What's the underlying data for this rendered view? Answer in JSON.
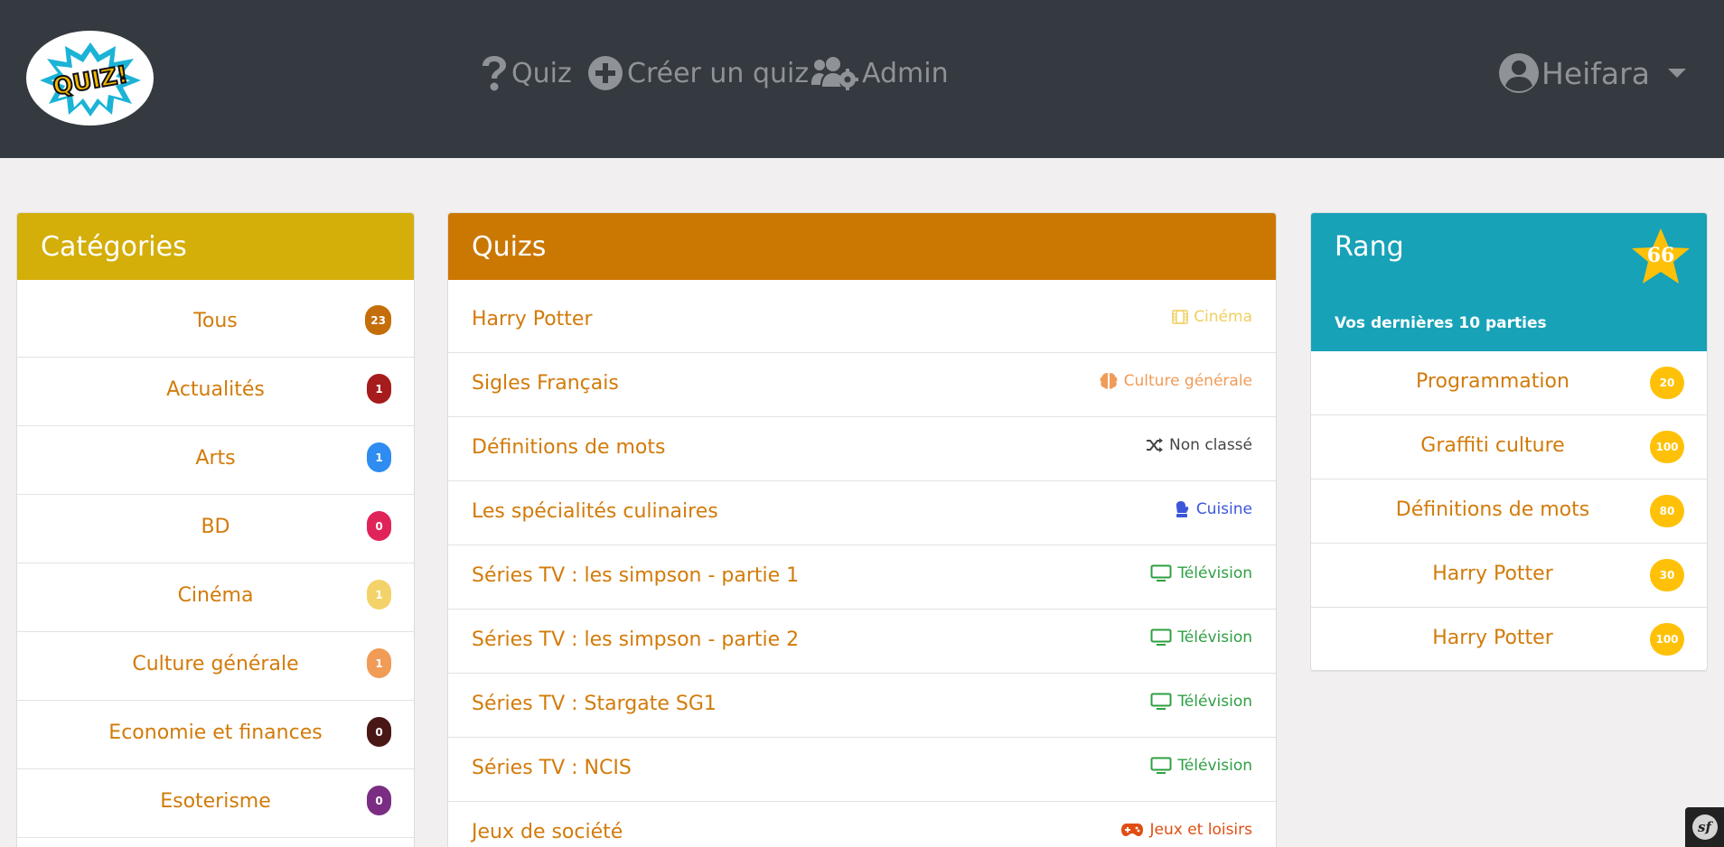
{
  "navbar": {
    "logo_text": "QUIZ!",
    "items": [
      {
        "label": "Quiz",
        "icon": "question-icon"
      },
      {
        "label": "Créer un quiz",
        "icon": "plus-circle-icon"
      },
      {
        "label": "Admin",
        "icon": "users-cog-icon"
      }
    ],
    "user": {
      "name": "Heifara",
      "icon": "user-circle-icon"
    }
  },
  "categories": {
    "title": "Catégories",
    "items": [
      {
        "label": "Tous",
        "count": "23",
        "color": "#c56e09"
      },
      {
        "label": "Actualités",
        "count": "1",
        "color": "#a61b1b"
      },
      {
        "label": "Arts",
        "count": "1",
        "color": "#2f8cf0"
      },
      {
        "label": "BD",
        "count": "0",
        "color": "#e0245a"
      },
      {
        "label": "Cinéma",
        "count": "1",
        "color": "#f3d369"
      },
      {
        "label": "Culture générale",
        "count": "1",
        "color": "#f09c57"
      },
      {
        "label": "Economie et finances",
        "count": "0",
        "color": "#4a1717"
      },
      {
        "label": "Esoterisme",
        "count": "0",
        "color": "#7a2d82"
      }
    ]
  },
  "quizs": {
    "title": "Quizs",
    "items": [
      {
        "title": "Harry Potter",
        "category": "Cinéma",
        "icon": "film-icon",
        "color": "#f0cf60"
      },
      {
        "title": "Sigles Français",
        "category": "Culture générale",
        "icon": "brain-icon",
        "color": "#f09c57"
      },
      {
        "title": "Définitions de mots",
        "category": "Non classé",
        "icon": "shuffle-icon",
        "color": "#444444"
      },
      {
        "title": "Les spécialités culinaires",
        "category": "Cuisine",
        "icon": "mitten-icon",
        "color": "#3b56d9"
      },
      {
        "title": "Séries TV : les simpson - partie 1",
        "category": "Télévision",
        "icon": "tv-icon",
        "color": "#2ea043"
      },
      {
        "title": "Séries TV : les simpson - partie 2",
        "category": "Télévision",
        "icon": "tv-icon",
        "color": "#2ea043"
      },
      {
        "title": "Séries TV : Stargate SG1",
        "category": "Télévision",
        "icon": "tv-icon",
        "color": "#2ea043"
      },
      {
        "title": "Séries TV : NCIS",
        "category": "Télévision",
        "icon": "tv-icon",
        "color": "#2ea043"
      },
      {
        "title": "Jeux de société",
        "category": "Jeux et loisirs",
        "icon": "gamepad-icon",
        "color": "#e04e12"
      }
    ]
  },
  "rank": {
    "title": "Rang",
    "value": "66",
    "subtitle": "Vos dernières 10 parties",
    "items": [
      {
        "label": "Programmation",
        "score": "20"
      },
      {
        "label": "Graffiti culture",
        "score": "100"
      },
      {
        "label": "Définitions de mots",
        "score": "80"
      },
      {
        "label": "Harry Potter",
        "score": "30"
      },
      {
        "label": "Harry Potter",
        "score": "100"
      }
    ]
  },
  "toolbar": {
    "symbol": "sf"
  }
}
